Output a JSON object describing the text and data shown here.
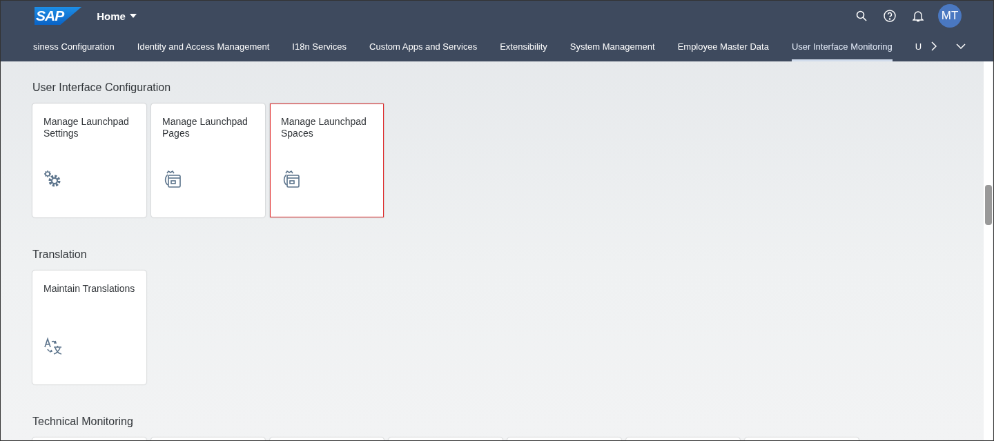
{
  "shell": {
    "logo": "SAP",
    "title": "Home",
    "avatar": "MT"
  },
  "tabs": [
    {
      "label": "siness Configuration",
      "selected": false
    },
    {
      "label": "Identity and Access Management",
      "selected": false
    },
    {
      "label": "I18n Services",
      "selected": false
    },
    {
      "label": "Custom Apps and Services",
      "selected": false
    },
    {
      "label": "Extensibility",
      "selected": false
    },
    {
      "label": "System Management",
      "selected": false
    },
    {
      "label": "Employee Master Data",
      "selected": false
    },
    {
      "label": "User Interface Monitoring",
      "selected": true
    },
    {
      "label": "U",
      "selected": false
    }
  ],
  "sections": [
    {
      "title": "User Interface Configuration",
      "tiles": [
        {
          "title": "Manage Launchpad Settings",
          "kind": "gears",
          "selected": false
        },
        {
          "title": "Manage Launchpad Pages",
          "kind": "page",
          "selected": false
        },
        {
          "title": "Manage Launchpad Spaces",
          "kind": "page",
          "selected": true
        }
      ]
    },
    {
      "title": "Translation",
      "tiles": [
        {
          "title": "Maintain Translations",
          "kind": "translate",
          "selected": false
        }
      ]
    },
    {
      "title": "Technical Monitoring",
      "tiles": [
        {
          "kind": "blank",
          "selected": false
        },
        {
          "kind": "blank",
          "selected": false
        },
        {
          "kind": "blank",
          "selected": false
        },
        {
          "kind": "blank",
          "selected": false
        },
        {
          "kind": "blank",
          "selected": false
        },
        {
          "kind": "blank",
          "selected": false
        },
        {
          "kind": "blank",
          "selected": false
        }
      ]
    }
  ]
}
